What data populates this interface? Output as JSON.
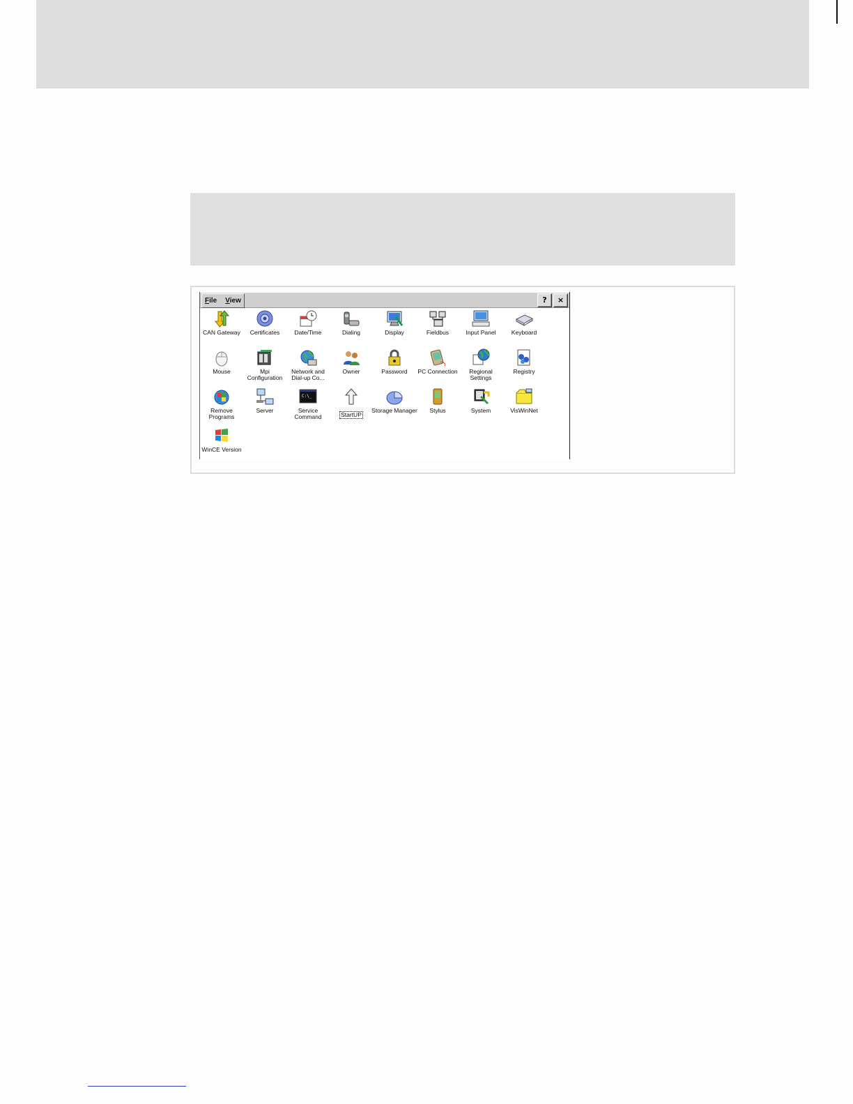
{
  "window": {
    "menu": [
      "File",
      "View"
    ],
    "help_button": "?",
    "close_button": "×"
  },
  "applets": [
    {
      "label": "CAN Gateway",
      "icon": "can-gateway-icon"
    },
    {
      "label": "Certificates",
      "icon": "certificates-icon"
    },
    {
      "label": "Date/Time",
      "icon": "date-time-icon"
    },
    {
      "label": "Dialing",
      "icon": "dialing-icon"
    },
    {
      "label": "Display",
      "icon": "display-icon"
    },
    {
      "label": "Fieldbus",
      "icon": "fieldbus-icon"
    },
    {
      "label": "Input Panel",
      "icon": "input-panel-icon"
    },
    {
      "label": "Keyboard",
      "icon": "keyboard-icon"
    },
    {
      "label": "Mouse",
      "icon": "mouse-icon"
    },
    {
      "label": "Mpi\nConfiguration",
      "icon": "mpi-configuration-icon"
    },
    {
      "label": "Network and\nDial-up Co...",
      "icon": "network-icon"
    },
    {
      "label": "Owner",
      "icon": "owner-icon"
    },
    {
      "label": "Password",
      "icon": "password-icon"
    },
    {
      "label": "PC Connection",
      "icon": "pc-connection-icon"
    },
    {
      "label": "Regional Settings",
      "icon": "regional-settings-icon"
    },
    {
      "label": "Registry",
      "icon": "registry-icon"
    },
    {
      "label": "Remove\nPrograms",
      "icon": "remove-programs-icon"
    },
    {
      "label": "Server",
      "icon": "server-icon"
    },
    {
      "label": "Service\nCommand",
      "icon": "service-command-icon"
    },
    {
      "label": "StartUP",
      "icon": "startup-icon"
    },
    {
      "label": "Storage Manager",
      "icon": "storage-manager-icon"
    },
    {
      "label": "Stylus",
      "icon": "stylus-icon"
    },
    {
      "label": "System",
      "icon": "system-icon"
    },
    {
      "label": "VisWinNet",
      "icon": "viswinnet-icon"
    },
    {
      "label": "WinCE Version",
      "icon": "wince-version-icon"
    }
  ]
}
